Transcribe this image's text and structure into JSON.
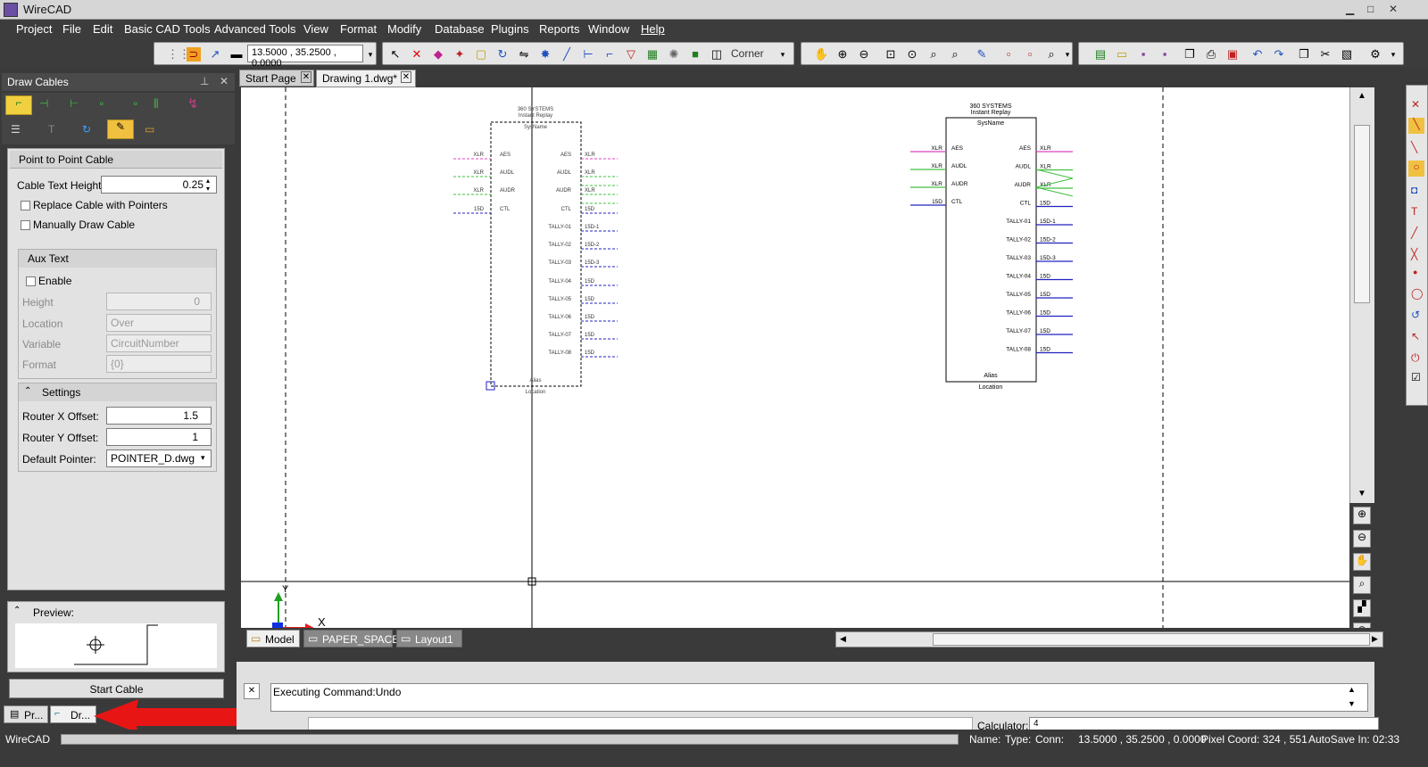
{
  "app": {
    "title": "WireCAD",
    "accent": "#3c3c3c"
  },
  "menu": [
    "Project",
    "File",
    "Edit",
    "Basic CAD Tools",
    "Advanced Tools",
    "View",
    "Format",
    "Modify",
    "Database",
    "Plugins",
    "Reports",
    "Window",
    "Help"
  ],
  "toolbar": {
    "coord_value": "13.5000 , 35.2500 , 0.0000",
    "corner_label": "Corner"
  },
  "panel": {
    "title": "Draw Cables",
    "section_title": "Point to Point Cable",
    "cable_text_height_label": "Cable Text Height:",
    "cable_text_height": "0.25",
    "replace_cable_label": "Replace Cable with Pointers",
    "manual_draw_label": "Manually Draw Cable",
    "aux_text": {
      "title": "Aux Text",
      "enable_label": "Enable",
      "height_label": "Height",
      "height_value": "0",
      "location_label": "Location",
      "location_value": "Over",
      "variable_label": "Variable",
      "variable_value": "CircuitNumber",
      "format_label": "Format",
      "format_value": "{0}"
    },
    "settings": {
      "title": "Settings",
      "router_x_label": "Router X Offset:",
      "router_x": "1.5",
      "router_y_label": "Router Y Offset:",
      "router_y": "1",
      "pointer_label": "Default Pointer:",
      "pointer": "POINTER_D.dwg"
    },
    "preview_label": "Preview:",
    "start_button": "Start Cable",
    "bottom_tabs": [
      "Pr...",
      "Dr..."
    ]
  },
  "doc_tabs": [
    {
      "label": "Start Page"
    },
    {
      "label": "Drawing 1.dwg*"
    }
  ],
  "layout_tabs": [
    "Model",
    "PAPER_SPACE",
    "Layout1"
  ],
  "drawing": {
    "block2": {
      "maker": "360 SYSTEMS",
      "model": "Instant Replay",
      "sysname": "SysName",
      "alias": "Alias",
      "location": "Location",
      "left_ports": [
        {
          "name": "AES",
          "type": "XLR",
          "color": "#e040c0"
        },
        {
          "name": "AUDL",
          "type": "XLR",
          "color": "#40c040"
        },
        {
          "name": "AUDR",
          "type": "XLR",
          "color": "#40c040"
        },
        {
          "name": "CTL",
          "type": "15D",
          "color": "#2020c0"
        }
      ],
      "right_ports": [
        {
          "name": "AES",
          "type": "XLR",
          "color": "#e040c0"
        },
        {
          "name": "AUDL",
          "type": "XLR",
          "color": "#40c040"
        },
        {
          "name": "AUDR",
          "type": "XLR",
          "color": "#40c040"
        },
        {
          "name": "CTL",
          "type": "15D",
          "color": "#2020c0"
        },
        {
          "name": "TALLY-01",
          "type": "15D-1",
          "color": "#2020c0"
        },
        {
          "name": "TALLY-02",
          "type": "15D-2",
          "color": "#2020c0"
        },
        {
          "name": "TALLY-03",
          "type": "15D-3",
          "color": "#2020c0"
        },
        {
          "name": "TALLY-04",
          "type": "15D",
          "color": "#2020c0"
        },
        {
          "name": "TALLY-05",
          "type": "15D",
          "color": "#2020c0"
        },
        {
          "name": "TALLY-06",
          "type": "15D",
          "color": "#2020c0"
        },
        {
          "name": "TALLY-07",
          "type": "15D",
          "color": "#2020c0"
        },
        {
          "name": "TALLY-08",
          "type": "15D",
          "color": "#2020c0"
        }
      ]
    },
    "axis_x": "X",
    "axis_y": "Y"
  },
  "command": {
    "output": "Executing Command:Undo",
    "calculator_label": "Calculator:",
    "calculator_value": "4"
  },
  "status": {
    "app": "WireCAD",
    "name": "Name:",
    "type": "Type:",
    "conn": "Conn:",
    "coord": "13.5000 , 35.2500 , 0.0000",
    "pixel": "Pixel Coord: 324 , 551",
    "autosave": "AutoSave In: 02:33"
  }
}
